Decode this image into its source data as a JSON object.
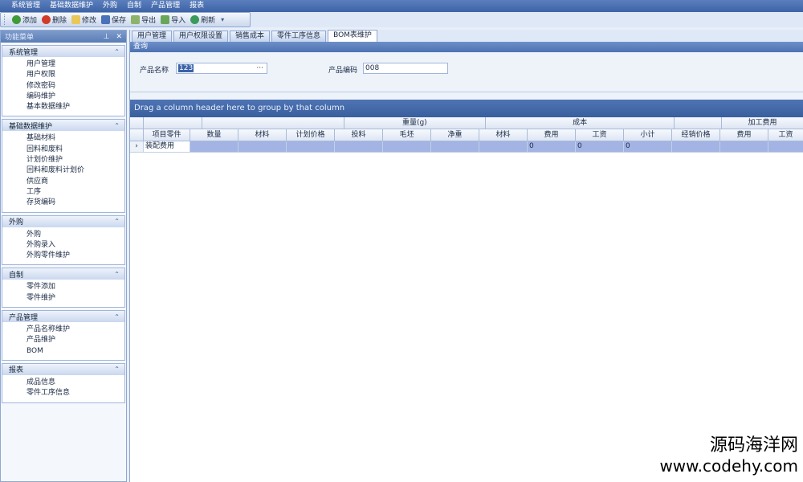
{
  "menu": [
    "系统管理",
    "基础数据维护",
    "外购",
    "自制",
    "产品管理",
    "报表"
  ],
  "toolbar": {
    "buttons": [
      {
        "label": "添加",
        "icon": "add-icon"
      },
      {
        "label": "删除",
        "icon": "delete-icon"
      },
      {
        "label": "修改",
        "icon": "edit-icon"
      },
      {
        "label": "保存",
        "icon": "save-icon"
      },
      {
        "label": "导出",
        "icon": "export-icon"
      },
      {
        "label": "导入",
        "icon": "import-icon"
      },
      {
        "label": "刷新",
        "icon": "refresh-icon"
      }
    ]
  },
  "left_panel": {
    "title": "功能菜单",
    "pin_glyph": "⊥",
    "close_glyph": "✕",
    "groups": [
      {
        "title": "系统管理",
        "items": [
          "用户管理",
          "用户权限",
          "修改密码",
          "编码维护",
          "基本数据维护"
        ]
      },
      {
        "title": "基础数据维护",
        "items": [
          "基础材料",
          "回料和废料",
          "计划价维护",
          "回料和废料计划价",
          "供应商",
          "工序",
          "存货编码"
        ]
      },
      {
        "title": "外购",
        "items": [
          "外购",
          "外购录入",
          "外购零件维护"
        ]
      },
      {
        "title": "自制",
        "items": [
          "零件添加",
          "零件维护"
        ]
      },
      {
        "title": "产品管理",
        "items": [
          "产品名称维护",
          "产品维护",
          "BOM"
        ]
      },
      {
        "title": "报表",
        "items": [
          "成品信息",
          "零件工序信息"
        ]
      }
    ]
  },
  "tabs": [
    {
      "label": "用户管理",
      "active": false
    },
    {
      "label": "用户权限设置",
      "active": false
    },
    {
      "label": "销售成本",
      "active": false
    },
    {
      "label": "零件工序信息",
      "active": false
    },
    {
      "label": "BOM表维护",
      "active": true
    }
  ],
  "query": {
    "title": "查询",
    "product_name_label": "产品名称",
    "product_name_value": "123",
    "ellipsis": "···",
    "product_code_label": "产品编码",
    "product_code_value": "008"
  },
  "group_panel_text": "Drag a column header here to group by that column",
  "grid": {
    "bands": [
      {
        "label": "",
        "width": 75
      },
      {
        "label": "",
        "width": 180
      },
      {
        "label": "重量(g)",
        "width": 180
      },
      {
        "label": "成本",
        "width": 240
      },
      {
        "label": "",
        "width": 60
      },
      {
        "label": "加工费用",
        "width": 104
      }
    ],
    "columns": [
      {
        "label": "项目零件",
        "width": 58
      },
      {
        "label": "数量",
        "width": 60
      },
      {
        "label": "材料",
        "width": 60
      },
      {
        "label": "计划价格",
        "width": 60
      },
      {
        "label": "投料",
        "width": 60
      },
      {
        "label": "毛坯",
        "width": 60
      },
      {
        "label": "净重",
        "width": 60
      },
      {
        "label": "材料",
        "width": 60
      },
      {
        "label": "费用",
        "width": 60
      },
      {
        "label": "工资",
        "width": 60
      },
      {
        "label": "小计",
        "width": 60
      },
      {
        "label": "经销价格",
        "width": 60
      },
      {
        "label": "费用",
        "width": 60
      },
      {
        "label": "工资",
        "width": 44
      }
    ],
    "rows": [
      {
        "indicator": "›",
        "cells": [
          "装配费用",
          "",
          "",
          "",
          "",
          "",
          "",
          "",
          "0",
          "0",
          "0",
          "",
          "",
          ""
        ]
      }
    ]
  },
  "watermark": {
    "line1": "源码海洋网",
    "line2": "www.codehy.com"
  }
}
